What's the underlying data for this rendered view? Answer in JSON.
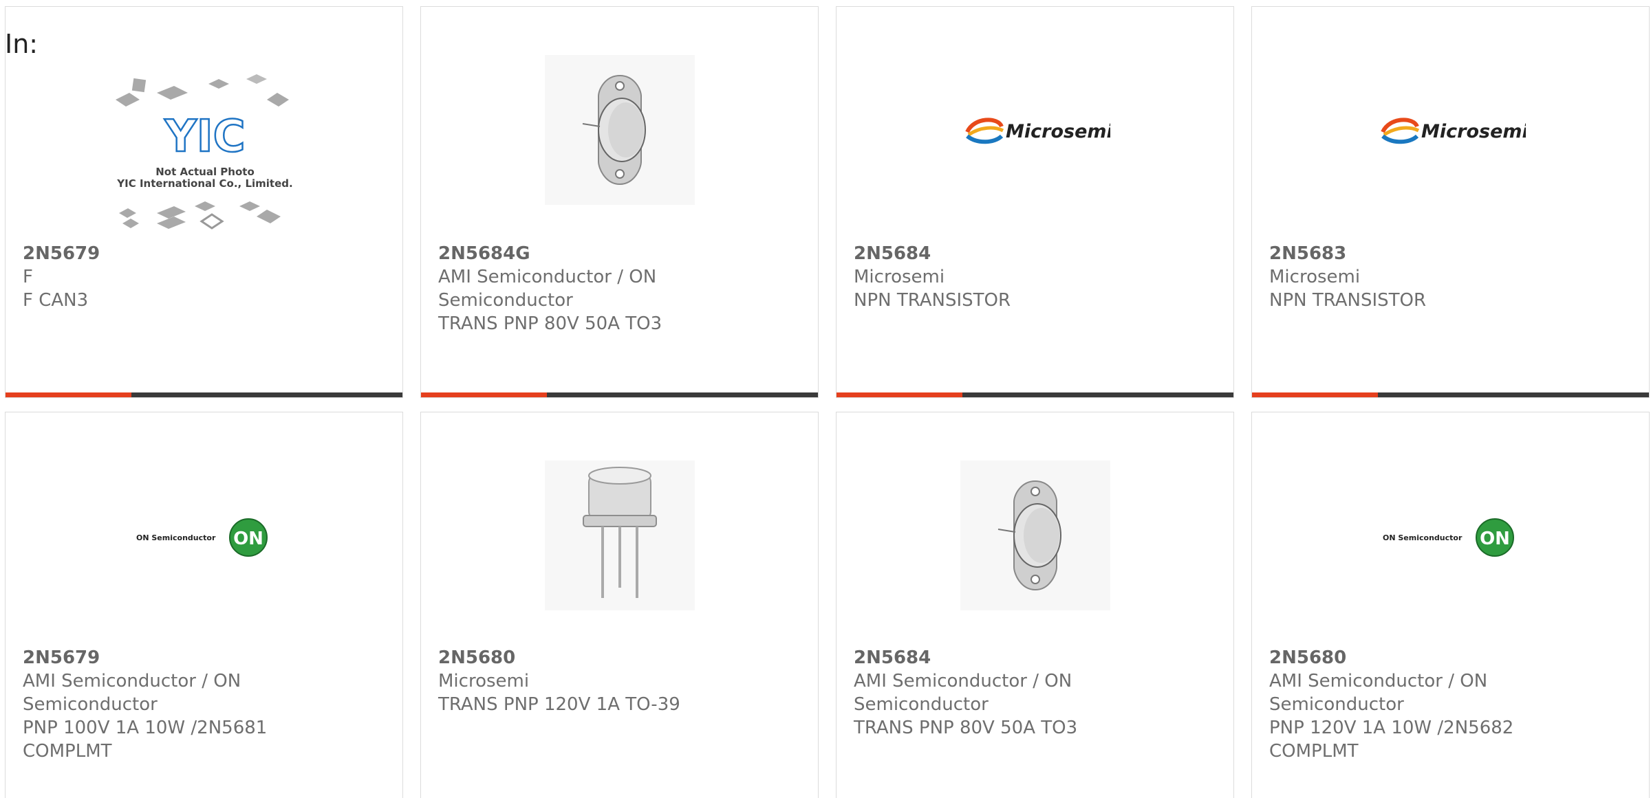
{
  "filter": {
    "label": "In:"
  },
  "products": [
    {
      "part_number": "2N5679",
      "manufacturer": "F",
      "description": "F CAN3",
      "image": "not-actual-photo-placeholder",
      "image_caption_line1": "Not Actual Photo",
      "image_caption_line2": "YIC International Co., Limited.",
      "image_logo_text": "YIC"
    },
    {
      "part_number": "2N5684G",
      "manufacturer": "AMI Semiconductor / ON Semiconductor",
      "description": "TRANS PNP 80V 50A TO3",
      "image": "to3-transistor-photo"
    },
    {
      "part_number": "2N5684",
      "manufacturer": "Microsemi",
      "description": "NPN TRANSISTOR",
      "image": "microsemi-logo",
      "logo_text": "Microsemi"
    },
    {
      "part_number": "2N5683",
      "manufacturer": "Microsemi",
      "description": "NPN TRANSISTOR",
      "image": "microsemi-logo",
      "logo_text": "Microsemi"
    },
    {
      "part_number": "2N5679",
      "manufacturer": "AMI Semiconductor / ON Semiconductor",
      "description": "PNP 100V 1A 10W /2N5681 COMPLMT",
      "image": "on-semiconductor-logo",
      "logo_text": "ON Semiconductor",
      "logo_badge": "ON"
    },
    {
      "part_number": "2N5680",
      "manufacturer": "Microsemi",
      "description": "TRANS PNP 120V 1A TO-39",
      "image": "to39-transistor-photo"
    },
    {
      "part_number": "2N5684",
      "manufacturer": "AMI Semiconductor / ON Semiconductor",
      "description": "TRANS PNP 80V 50A TO3",
      "image": "to3-transistor-photo"
    },
    {
      "part_number": "2N5680",
      "manufacturer": "AMI Semiconductor / ON Semiconductor",
      "description": "PNP 120V 1A 10W /2N5682 COMPLMT",
      "image": "on-semiconductor-logo",
      "logo_text": "ON Semiconductor",
      "logo_badge": "ON"
    }
  ],
  "colors": {
    "accent": "#e5401e",
    "bar": "#3a3a3a",
    "border": "#dcdcdc",
    "text": "#6e6e6e"
  }
}
